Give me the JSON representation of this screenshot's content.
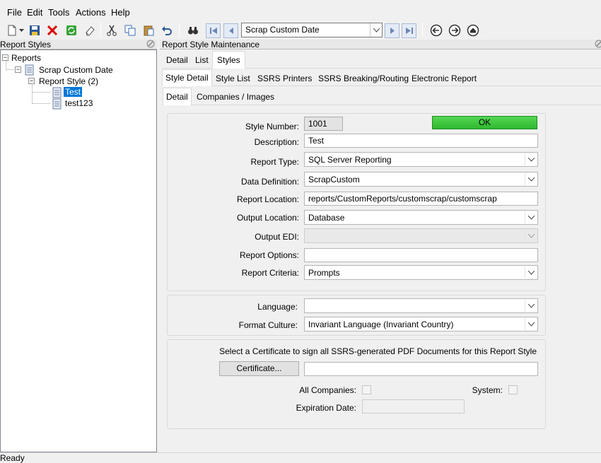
{
  "menu": [
    "File",
    "Edit",
    "Tools",
    "Actions",
    "Help"
  ],
  "toolbar": {
    "style_combo": "Scrap Custom Date"
  },
  "left_panel": {
    "title": "Report Styles",
    "tree": {
      "root": "Reports",
      "style": "Scrap Custom Date",
      "group": "Report Style (2)",
      "items": [
        "Test",
        "test123"
      ],
      "selected": "Test"
    }
  },
  "right_panel": {
    "title": "Report Style Maintenance",
    "tabs_top": [
      "Detail",
      "List",
      "Styles"
    ],
    "tabs_mid": [
      "Style Detail",
      "Style List",
      "SSRS Printers",
      "SSRS Breaking/Routing",
      "Electronic Report"
    ],
    "tabs_sub": [
      "Detail",
      "Companies / Images"
    ]
  },
  "form": {
    "style_number_label": "Style Number:",
    "style_number": "1001",
    "ok_label": "OK",
    "description_label": "Description:",
    "description": "Test",
    "report_type_label": "Report Type:",
    "report_type": "SQL Server Reporting",
    "data_definition_label": "Data Definition:",
    "data_definition": "ScrapCustom",
    "report_location_label": "Report Location:",
    "report_location": "reports/CustomReports/customscrap/customscrap",
    "output_location_label": "Output Location:",
    "output_location": "Database",
    "output_edi_label": "Output EDI:",
    "output_edi": "",
    "report_options_label": "Report Options:",
    "report_options": "",
    "report_criteria_label": "Report Criteria:",
    "report_criteria": "Prompts",
    "language_label": "Language:",
    "language": "",
    "format_culture_label": "Format Culture:",
    "format_culture": "Invariant Language (Invariant Country)",
    "certificate_note": "Select a Certificate to sign all SSRS-generated PDF Documents for this Report Style",
    "certificate_button": "Certificate...",
    "certificate_value": "",
    "all_companies_label": "All Companies:",
    "system_label": "System:",
    "expiration_label": "Expiration Date:",
    "expiration_value": ""
  },
  "status": "Ready",
  "colors": {
    "ok_green": "#3cc43c",
    "selection_blue": "#0078d7"
  }
}
